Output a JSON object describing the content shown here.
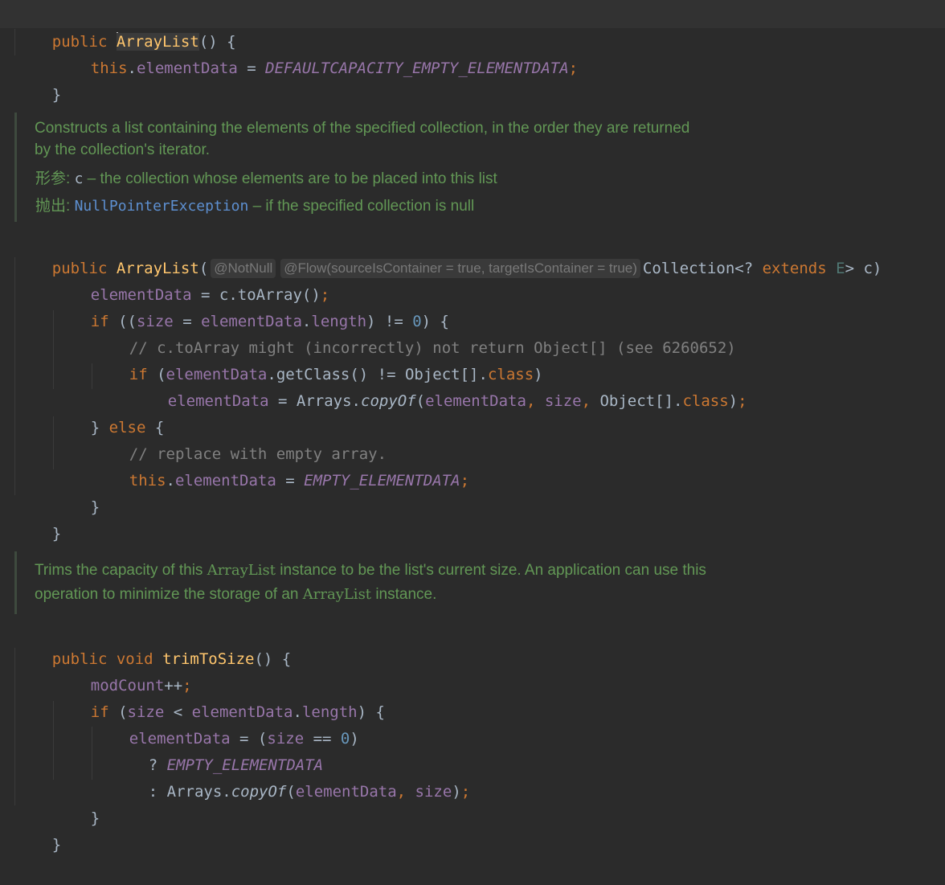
{
  "code": {
    "l1": {
      "kw": "public",
      "fn": "ArrayList",
      "rest": "() {"
    },
    "l2": {
      "this": "this",
      "dot": ".",
      "field": "elementData",
      "eq": " = ",
      "const": "DEFAULTCAPACITY_EMPTY_ELEMENTDATA",
      "semi": ";"
    },
    "l3": {
      "brace": "}"
    },
    "l4": {
      "kw": "public",
      "fn": "ArrayList",
      "open": "(",
      "type": "Collection<? ",
      "ext": "extends",
      "tparam": "E",
      "close": "> c)"
    },
    "l5": {
      "field": "elementData",
      "rest": " = c.toArray()",
      "semi": ";"
    },
    "l6": {
      "kw": "if",
      "p1": " ((",
      "size": "size",
      "eq": " = ",
      "field": "elementData",
      "dot": ".",
      "len": "length",
      "p2": ") != ",
      "num": "0",
      "p3": ") {"
    },
    "l7": {
      "comment": "// c.toArray might (incorrectly) not return Object[] (see 6260652)"
    },
    "l8": {
      "kw": "if",
      "p1": " (",
      "field": "elementData",
      "p2": ".getClass() != Object[].",
      "cls": "class",
      "p3": ")"
    },
    "l9": {
      "field": "elementData",
      "p1": " = Arrays.",
      "meth": "copyOf",
      "p2": "(",
      "arg1": "elementData",
      "comma1": ", ",
      "arg2": "size",
      "comma2": ", ",
      "p3": "Object[].",
      "cls": "class",
      "p4": ")",
      "semi": ";"
    },
    "l10": {
      "brace": "} ",
      "kw": "else",
      "rest": " {"
    },
    "l11": {
      "comment": "// replace with empty array."
    },
    "l12": {
      "this": "this",
      "dot": ".",
      "field": "elementData",
      "eq": " = ",
      "const": "EMPTY_ELEMENTDATA",
      "semi": ";"
    },
    "l13": {
      "brace": "}"
    },
    "l14": {
      "brace": "}"
    },
    "l15": {
      "kw1": "public",
      "kw2": "void",
      "fn": "trimToSize",
      "rest": "() {"
    },
    "l16": {
      "field": "modCount",
      "op": "++",
      "semi": ";"
    },
    "l17": {
      "kw": "if",
      "p1": " (",
      "size": "size",
      "lt": " < ",
      "field": "elementData",
      "dot": ".",
      "len": "length",
      "p2": ") {"
    },
    "l18": {
      "field": "elementData",
      "p1": " = (",
      "size": "size",
      "eq": " == ",
      "num": "0",
      "p2": ")"
    },
    "l19": {
      "q": "? ",
      "const": "EMPTY_ELEMENTDATA"
    },
    "l20": {
      "c": ": Arrays.",
      "meth": "copyOf",
      "p1": "(",
      "arg1": "elementData",
      "comma": ", ",
      "arg2": "size",
      "p2": ")",
      "semi": ";"
    },
    "l21": {
      "brace": "}"
    },
    "l22": {
      "brace": "}"
    }
  },
  "inlay_hints": {
    "notnull": "@NotNull",
    "flow": "@Flow(sourceIsContainer = true, targetIsContainer = true)"
  },
  "doc1": {
    "line1": "Constructs a list containing the elements of the specified collection, in the order they are returned",
    "line2": "by the collection's iterator.",
    "param_tag": "形参:",
    "param_name": "c",
    "param_desc": " – the collection whose elements are to be placed into this list",
    "throws_tag": "抛出:",
    "throws_name": "NullPointerException",
    "throws_desc": " – if the specified collection is null"
  },
  "doc2": {
    "l1a": "Trims the capacity of this ",
    "l1code": "ArrayList",
    "l1b": " instance to be the list's current size. An application can use this",
    "l2a": "operation to minimize the storage of an ",
    "l2code": "ArrayList",
    "l2b": " instance."
  }
}
